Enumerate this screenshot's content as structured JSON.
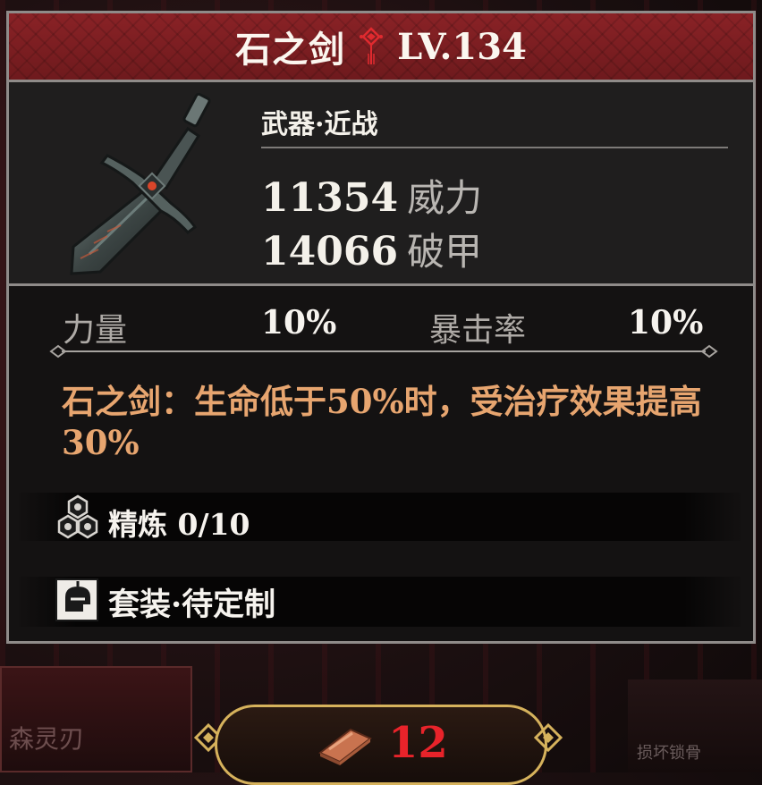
{
  "background": {
    "left_panel_text": "森灵刃",
    "right_panel_text": "损坏锁骨"
  },
  "item": {
    "name": "石之剑",
    "level": "LV.134",
    "type": "武器·近战",
    "stats": [
      {
        "value": "11354",
        "label": "威力"
      },
      {
        "value": "14066",
        "label": "破甲"
      }
    ],
    "attributes": [
      {
        "label": "力量",
        "value": "10%"
      },
      {
        "label": "暴击率",
        "value": "10%"
      }
    ],
    "description": "石之剑：生命低于50%时，受治疗效果提高30%",
    "refine": "精炼 0/10",
    "set": "套装·待定制"
  },
  "cost": {
    "amount": "12",
    "icon": "ingot-icon"
  },
  "colors": {
    "header_red": "#8a2226",
    "description": "#e7a56f",
    "cost_red": "#e8232a",
    "frame": "#8f8b89"
  }
}
